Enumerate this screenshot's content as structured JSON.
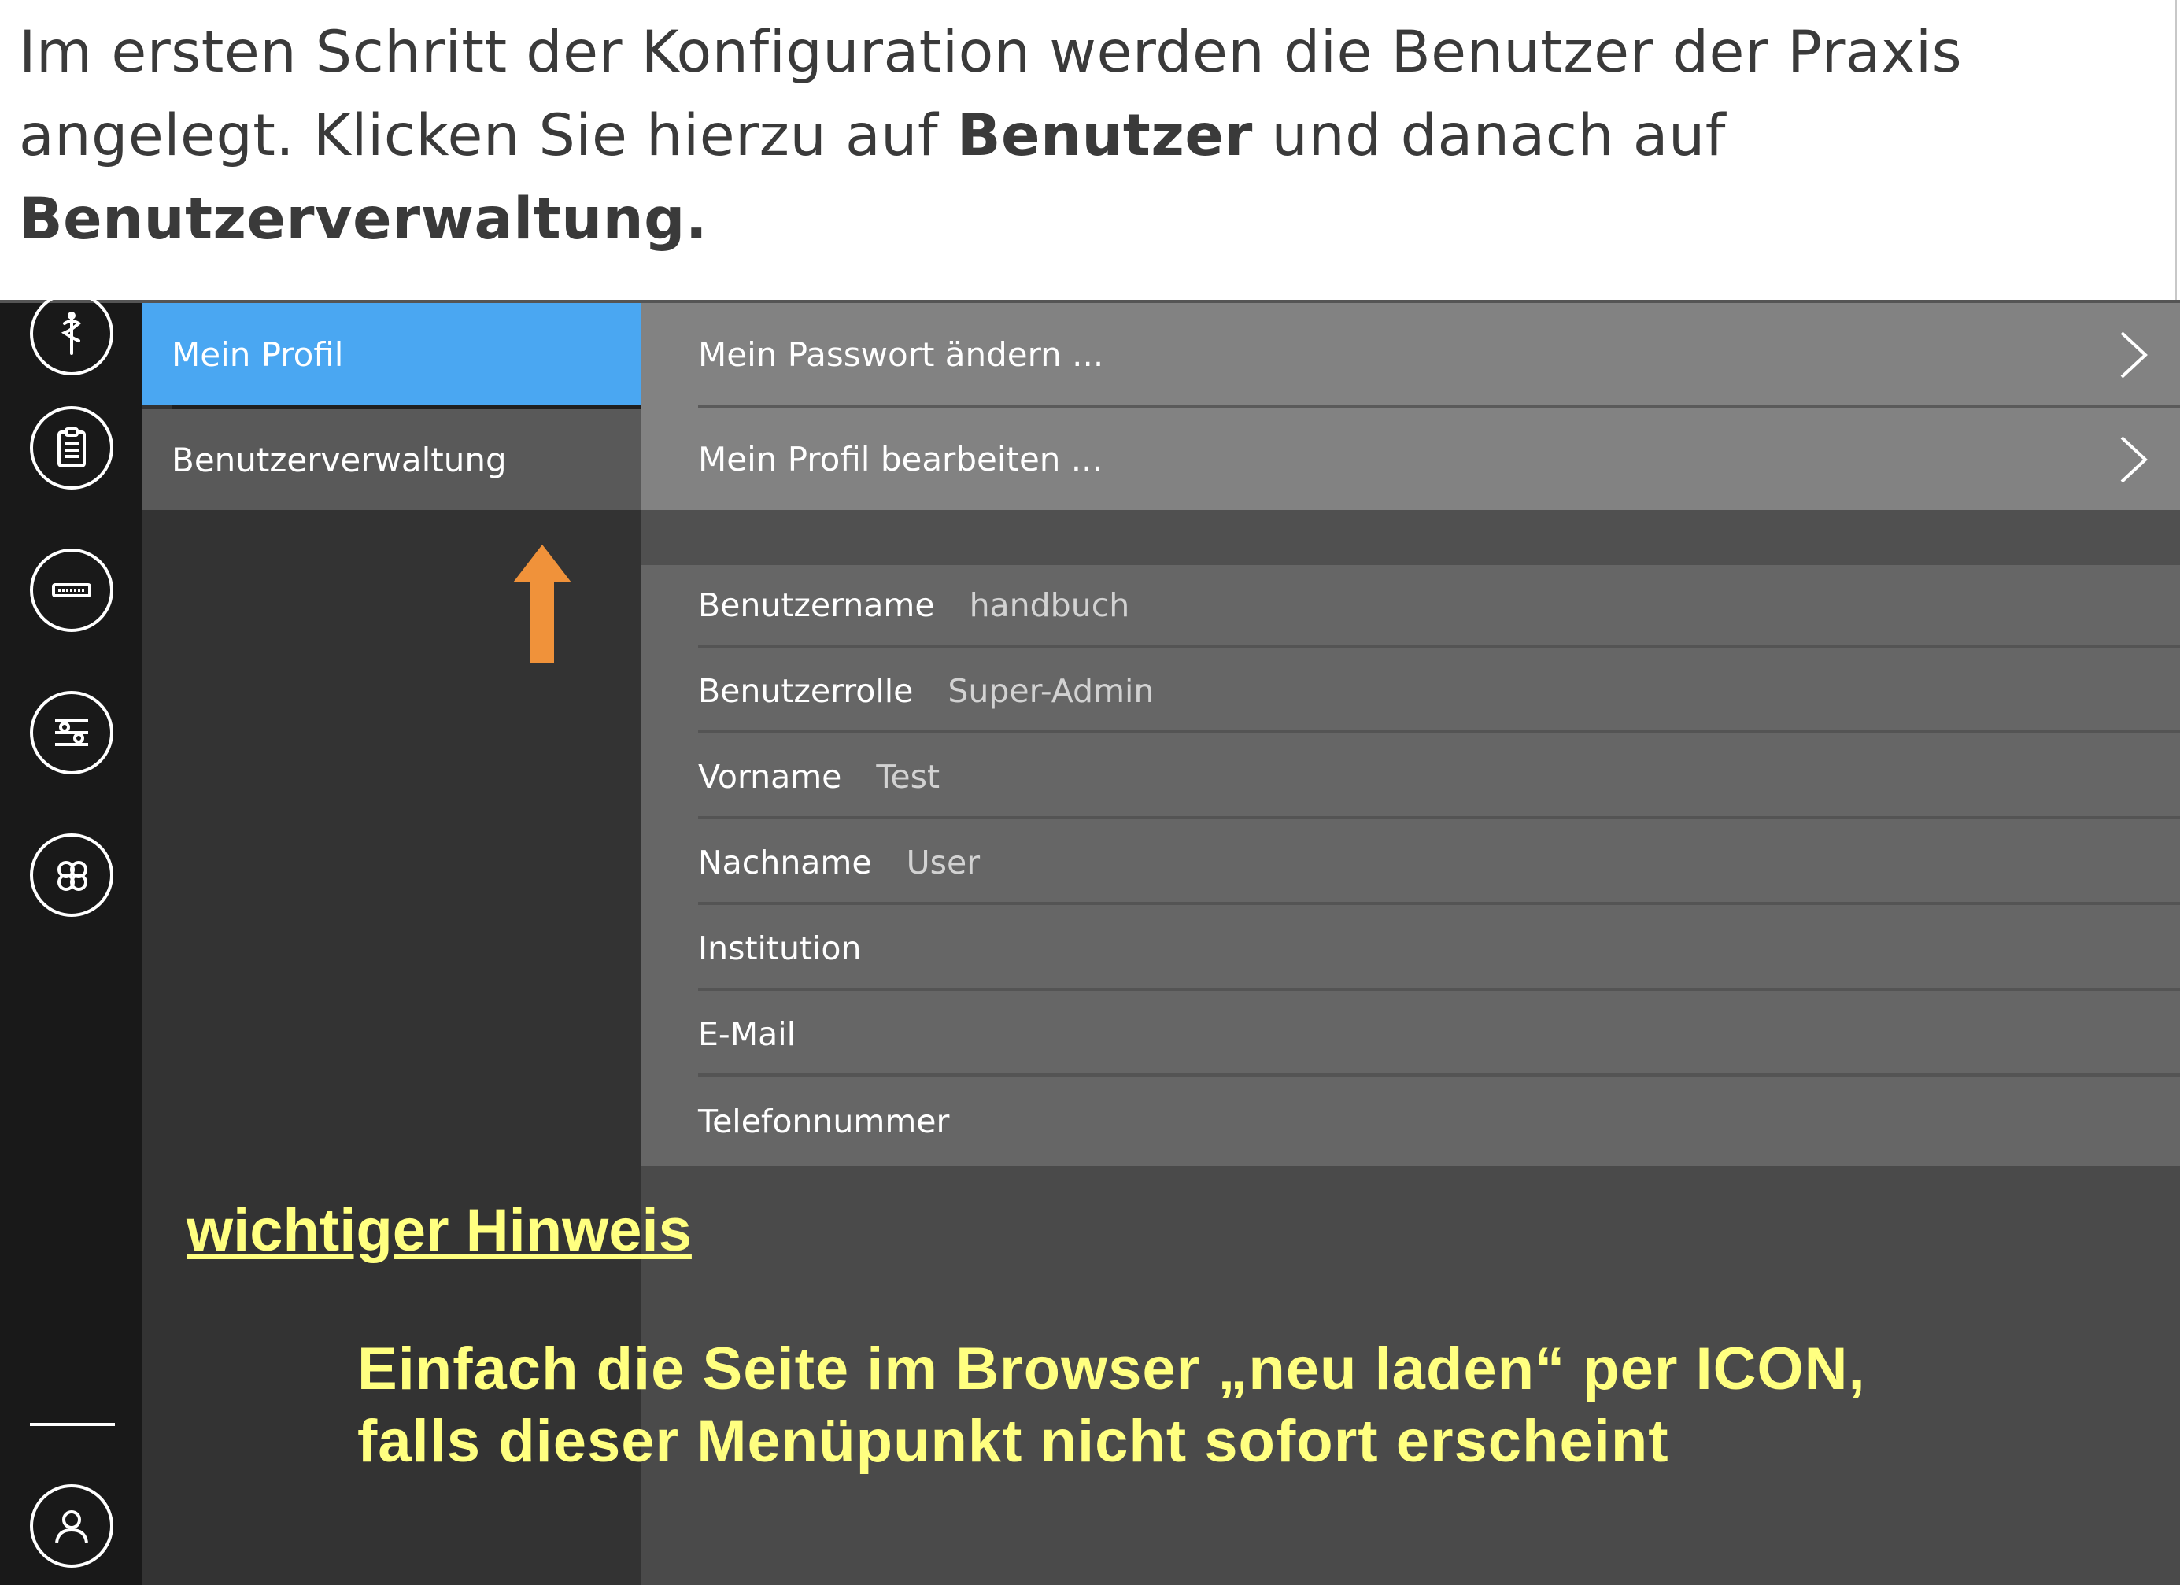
{
  "instruction": {
    "part1": "Im ersten Schritt der Konfiguration werden die Benutzer der Praxis angelegt. Klicken Sie hierzu auf ",
    "bold1": "Benutzer",
    "part2": " und danach auf",
    "bold2": "Benutzerverwaltung."
  },
  "sidebar": {
    "icons": [
      "caduceus-icon",
      "clipboard-icon",
      "device-icon",
      "sliders-icon",
      "hexagons-icon"
    ],
    "bottom_icon": "user-icon"
  },
  "menu": {
    "items": [
      {
        "label": "Mein Profil",
        "active": true
      },
      {
        "label": "Benutzerverwaltung",
        "active": false
      }
    ],
    "active_color": "#4aa7f2"
  },
  "actions": [
    {
      "label": "Mein Passwort ändern ..."
    },
    {
      "label": "Mein Profil bearbeiten ..."
    }
  ],
  "profile": {
    "fields": [
      {
        "label": "Benutzername",
        "value": "handbuch"
      },
      {
        "label": "Benutzerrolle",
        "value": "Super-Admin"
      },
      {
        "label": "Vorname",
        "value": "Test"
      },
      {
        "label": "Nachname",
        "value": "User"
      },
      {
        "label": "Institution",
        "value": ""
      },
      {
        "label": "E-Mail",
        "value": ""
      },
      {
        "label": "Telefonnummer",
        "value": ""
      }
    ]
  },
  "annotation": {
    "arrow_color": "#f0923a",
    "note_color": "#ffff80",
    "heading": "wichtiger Hinweis",
    "line1": "Einfach die Seite im Browser „neu laden“ per ICON,",
    "line2": "falls dieser Menüpunkt nicht sofort erscheint"
  }
}
